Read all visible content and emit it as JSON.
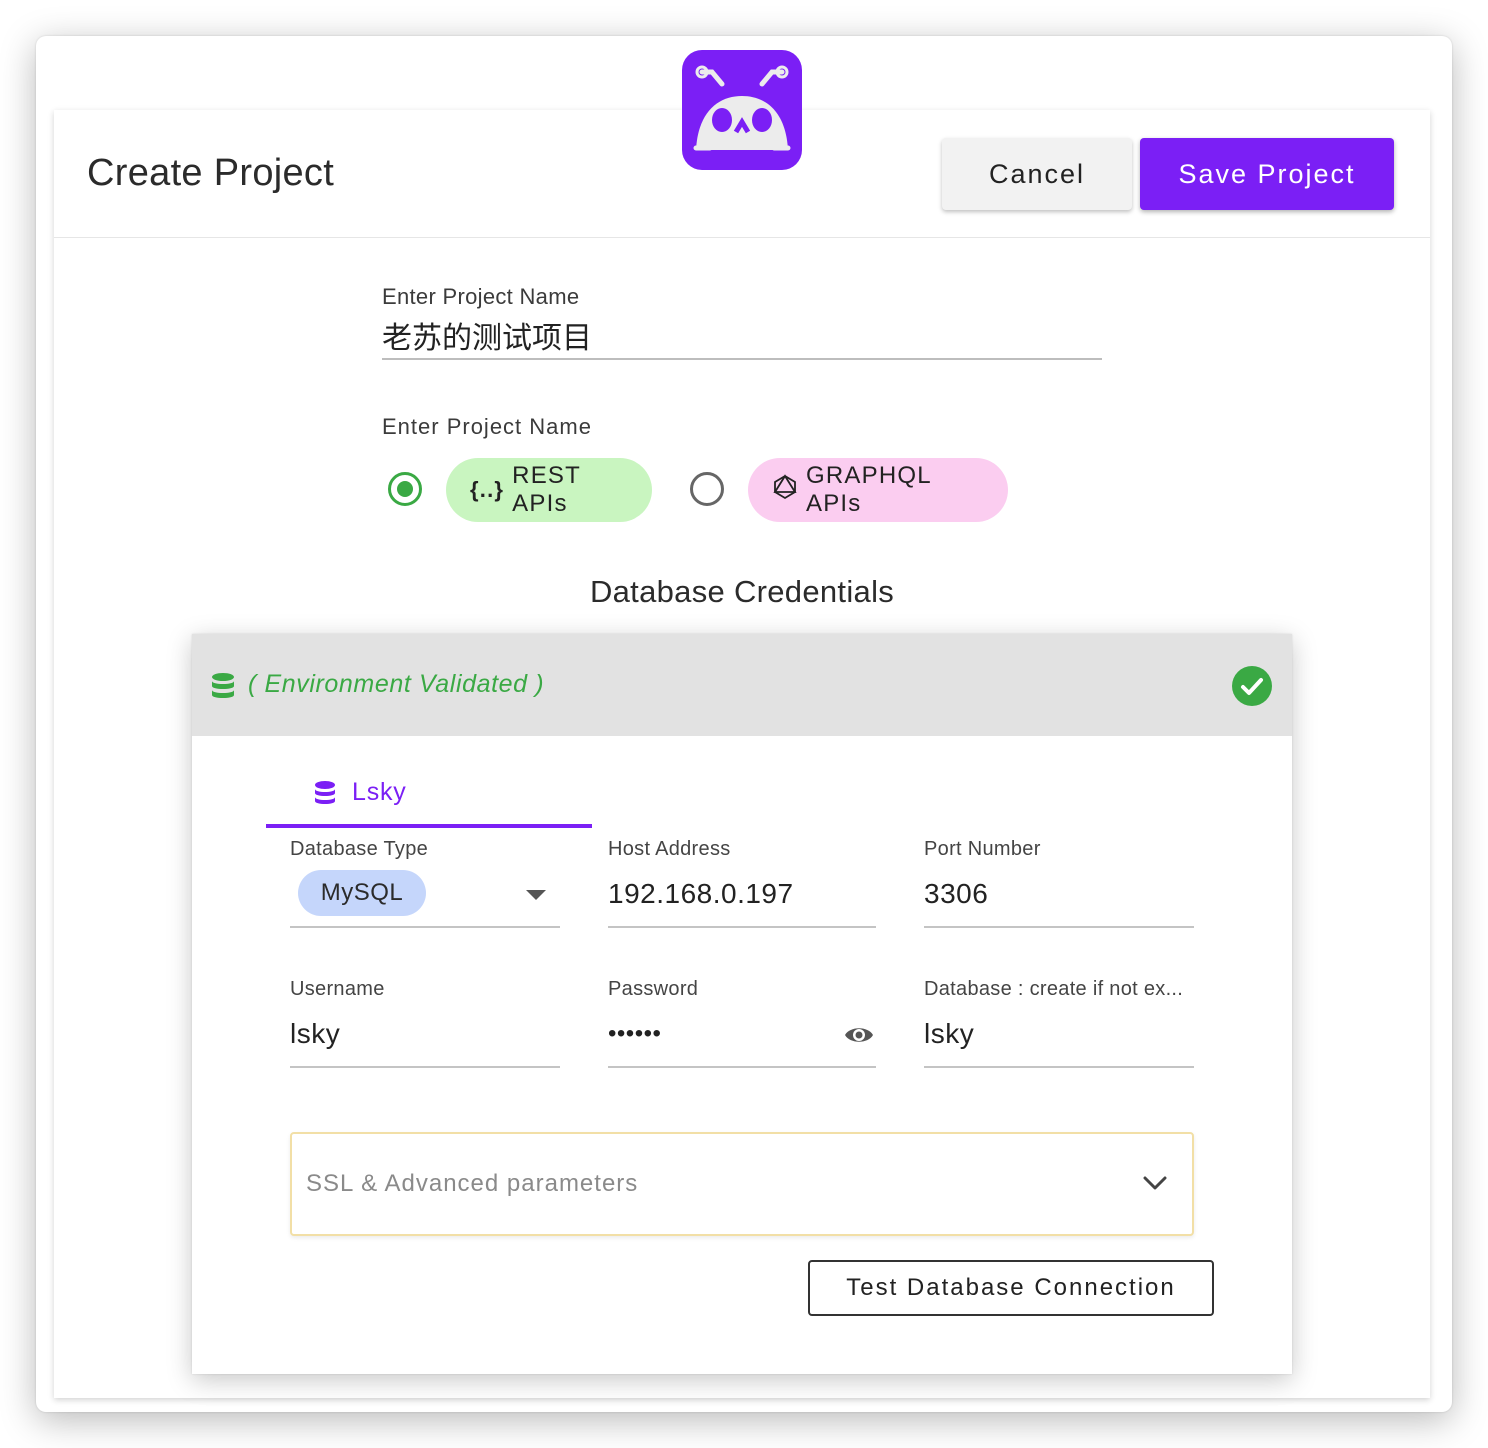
{
  "header": {
    "title": "Create Project",
    "cancel_label": "Cancel",
    "save_label": "Save Project"
  },
  "project_name": {
    "label": "Enter Project Name",
    "value": "老苏的测试项目"
  },
  "api_type": {
    "label": "Enter Project Name",
    "options": [
      {
        "label": "REST APIs",
        "icon": "curly-braces-icon",
        "selected": true,
        "color": "#c9f5c0"
      },
      {
        "label": "GRAPHQL APIs",
        "icon": "graphql-icon",
        "selected": false,
        "color": "#fbcdf0"
      }
    ]
  },
  "db_section": {
    "title": "Database Credentials",
    "status_text": "( Environment Validated )",
    "status_color": "#3aa944",
    "tab_label": "Lsky",
    "fields": {
      "db_type": {
        "label": "Database Type",
        "value": "MySQL"
      },
      "host": {
        "label": "Host Address",
        "value": "192.168.0.197"
      },
      "port": {
        "label": "Port Number",
        "value": "3306"
      },
      "username": {
        "label": "Username",
        "value": "lsky"
      },
      "password": {
        "label": "Password",
        "value": "••••••"
      },
      "database": {
        "label": "Database : create if not ex...",
        "value": "lsky"
      }
    },
    "ssl_label": "SSL & Advanced parameters",
    "test_label": "Test Database Connection"
  },
  "colors": {
    "accent": "#7b1ff5",
    "success": "#3aa944",
    "mysql_chip": "#c5d6fb"
  }
}
